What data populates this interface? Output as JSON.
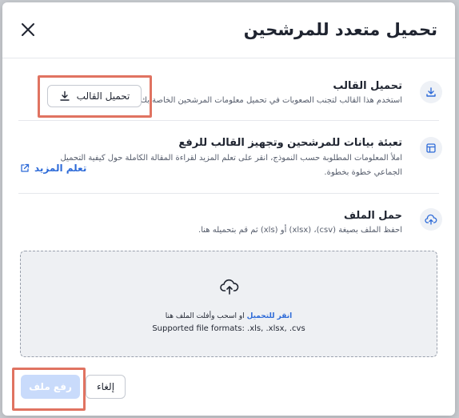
{
  "dialog": {
    "title": "تحميل متعدد للمرشحين",
    "close_icon": "close-icon"
  },
  "steps": [
    {
      "icon": "download-icon",
      "title": "تحميل القالب",
      "description": "استخدم هذا القالب لتجنب الصعوبات في تحميل معلومات المرشحين الخاصة بك.",
      "button_label": "تحميل القالب"
    },
    {
      "icon": "layout-icon",
      "title": "تعبئة بيانات للمرشحين وتجهيز القالب للرفع",
      "description_line1": "املأ المعلومات المطلوبة حسب النموذج، انقر على تعلم المزيد لقراءة المقالة الكاملة حول كيفية التحميل",
      "description_line2": "الجماعي خطوة بخطوة.",
      "link_label": "تعلم المزيد"
    },
    {
      "icon": "cloud-upload-icon",
      "title": "حمل الملف",
      "description": "احفظ الملف بصيغة (csv)، (xlsx) أو (xls) ثم قم بتحميله هنا."
    }
  ],
  "dropzone": {
    "link_text": "انقر للتحميل",
    "text": " او اسحب وأفلت الملف هنا",
    "formats": "Supported file formats: .xls, .xlsx, .cvs"
  },
  "footer": {
    "upload_label": "رفع ملف",
    "cancel_label": "إلغاء"
  },
  "colors": {
    "accent": "#2e6bd8",
    "highlight": "#e07361",
    "upload_disabled": "#c9dbfb"
  }
}
